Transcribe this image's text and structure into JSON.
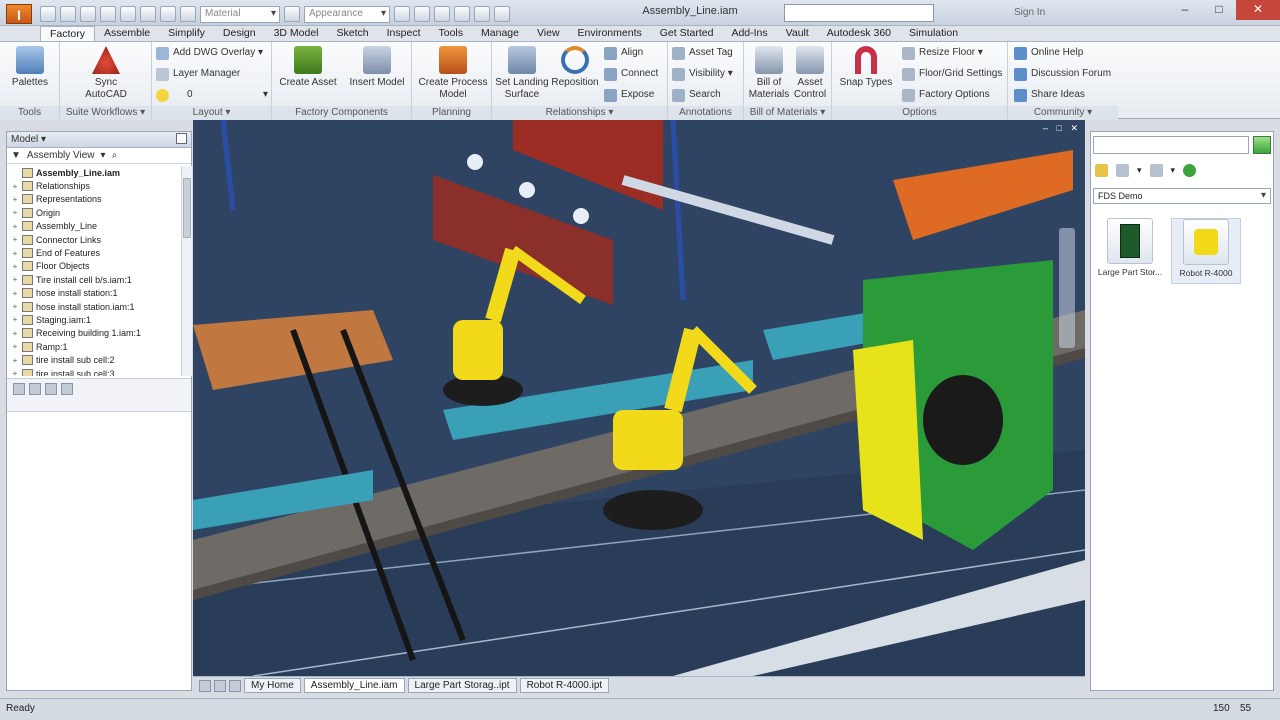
{
  "app": {
    "icon_letter": "I",
    "document_title": "Assembly_Line.iam",
    "material_select": "Material",
    "appearance_select": "Appearance",
    "sign_in": "Sign In",
    "window_controls": {
      "minimize": "–",
      "maximize": "□",
      "close": "✕"
    }
  },
  "ribbon_tabs": [
    "Factory",
    "Assemble",
    "Simplify",
    "Design",
    "3D Model",
    "Sketch",
    "Inspect",
    "Tools",
    "Manage",
    "View",
    "Environments",
    "Get Started",
    "Add-Ins",
    "Vault",
    "Autodesk 360",
    "Simulation"
  ],
  "ribbon": {
    "tools": {
      "title": "Tools",
      "palettes": "Palettes"
    },
    "suite": {
      "title": "Suite Workflows ▾",
      "sync": "Sync",
      "autocad": "AutoCAD"
    },
    "layout": {
      "title": "Layout ▾",
      "add_dwg": "Add DWG Overlay ▾",
      "layer_manager": "Layer Manager",
      "layer_value": "0"
    },
    "factory_components": {
      "title": "Factory Components",
      "create_asset": "Create Asset",
      "insert_model": "Insert Model"
    },
    "planning": {
      "title": "Planning",
      "create_process": "Create Process",
      "model": "Model"
    },
    "relationships": {
      "title": "Relationships ▾",
      "set_landing": "Set Landing",
      "surface": "Surface",
      "reposition": "Reposition",
      "align": "Align",
      "connect": "Connect",
      "expose": "Expose"
    },
    "annotations": {
      "title": "Annotations",
      "asset_tag": "Asset Tag",
      "visibility": "Visibility ▾",
      "search": "Search"
    },
    "bom": {
      "title": "Bill of Materials ▾",
      "bill_of": "Bill of",
      "materials": "Materials",
      "asset": "Asset",
      "control": "Control"
    },
    "options": {
      "title": "Options",
      "snap_types": "Snap Types",
      "resize_floor": "Resize Floor ▾",
      "floor_grid": "Floor/Grid Settings",
      "factory_options": "Factory Options"
    },
    "community": {
      "title": "Community ▾",
      "online_help": "Online Help",
      "discussion_forum": "Discussion Forum",
      "share_ideas": "Share Ideas"
    }
  },
  "browser": {
    "header": "Model ▾",
    "view": "Assembly View",
    "items": [
      {
        "label": "Assembly_Line.iam",
        "root": true
      },
      {
        "label": "Relationships"
      },
      {
        "label": "Representations"
      },
      {
        "label": "Origin"
      },
      {
        "label": "Assembly_Line"
      },
      {
        "label": "Connector Links"
      },
      {
        "label": "End of Features"
      },
      {
        "label": "Floor Objects"
      },
      {
        "label": "Tire install cell b/s.iam:1"
      },
      {
        "label": "hose install station:1"
      },
      {
        "label": "hose install station.iam:1"
      },
      {
        "label": "Staging.iam:1"
      },
      {
        "label": "Receiving building 1.iam:1"
      },
      {
        "label": "Ramp:1"
      },
      {
        "label": "tire install sub cell:2"
      },
      {
        "label": "tire install sub cell:3"
      }
    ]
  },
  "doc_tabs": [
    "My Home",
    "Assembly_Line.iam",
    "Large Part Storag..ipt",
    "Robot R-4000.ipt"
  ],
  "content_center": {
    "library": "FDS Demo",
    "assets": [
      {
        "label": "Large Part Stor..."
      },
      {
        "label": "Robot R-4000"
      }
    ]
  },
  "status": {
    "text": "Ready",
    "value_a": "150",
    "value_b": "55"
  }
}
